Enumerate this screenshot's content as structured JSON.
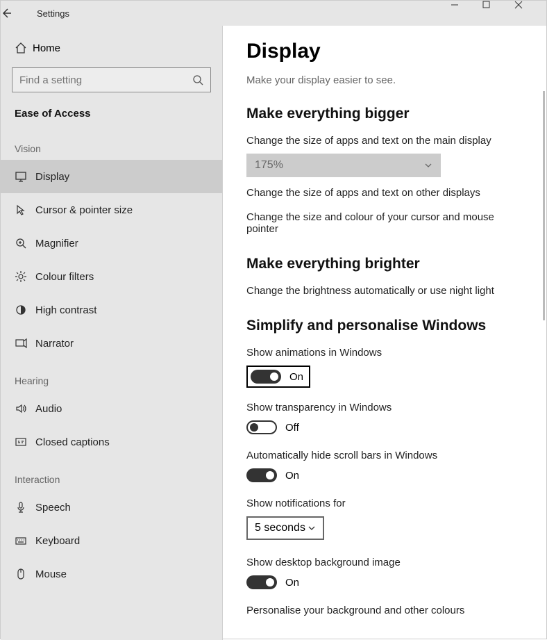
{
  "titlebar": {
    "title": "Settings"
  },
  "sidebar": {
    "home": "Home",
    "search_placeholder": "Find a setting",
    "group": "Ease of Access",
    "categories": {
      "vision": "Vision",
      "hearing": "Hearing",
      "interaction": "Interaction"
    },
    "items": {
      "display": "Display",
      "cursor": "Cursor & pointer size",
      "magnifier": "Magnifier",
      "colour": "Colour filters",
      "contrast": "High contrast",
      "narrator": "Narrator",
      "audio": "Audio",
      "captions": "Closed captions",
      "speech": "Speech",
      "keyboard": "Keyboard",
      "mouse": "Mouse"
    }
  },
  "main": {
    "title": "Display",
    "subtitle": "Make your display easier to see.",
    "section1": {
      "heading": "Make everything bigger",
      "label1": "Change the size of apps and text on the main display",
      "dropdown1": "175%",
      "link1": "Change the size of apps and text on other displays",
      "link2": "Change the size and colour of your cursor and mouse pointer"
    },
    "section2": {
      "heading": "Make everything brighter",
      "link1": "Change the brightness automatically or use night light"
    },
    "section3": {
      "heading": "Simplify and personalise Windows",
      "opt1": "Show animations in Windows",
      "opt1_state": "On",
      "opt2": "Show transparency in Windows",
      "opt2_state": "Off",
      "opt3": "Automatically hide scroll bars in Windows",
      "opt3_state": "On",
      "opt4": "Show notifications for",
      "opt4_value": "5 seconds",
      "opt5": "Show desktop background image",
      "opt5_state": "On",
      "link1": "Personalise your background and other colours"
    }
  }
}
